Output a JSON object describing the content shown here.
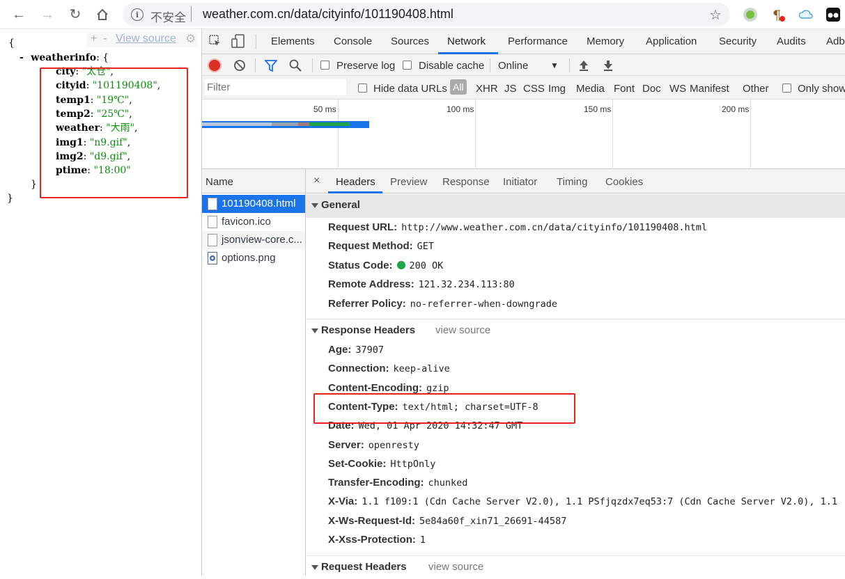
{
  "browser": {
    "insecure_label": "不安全",
    "url": "weather.com.cn/data/cityinfo/101190408.html",
    "icons": [
      "back-icon",
      "forward-icon",
      "reload-icon",
      "home-icon",
      "info-icon",
      "star-icon"
    ]
  },
  "json_view": {
    "tools_plus": "+",
    "tools_minus": "-",
    "view_source": "View source",
    "open_brace": "{",
    "root_key": "weatherinfo",
    "collapse": "-",
    "inner_open": "{",
    "inner_close": "}",
    "outer_close": "}",
    "fields": [
      {
        "key": "city",
        "value": "\"太仓\""
      },
      {
        "key": "cityid",
        "value": "\"101190408\""
      },
      {
        "key": "temp1",
        "value": "\"19℃\""
      },
      {
        "key": "temp2",
        "value": "\"25℃\""
      },
      {
        "key": "weather",
        "value": "\"大雨\""
      },
      {
        "key": "img1",
        "value": "\"n9.gif\""
      },
      {
        "key": "img2",
        "value": "\"d9.gif\""
      },
      {
        "key": "ptime",
        "value": "\"18:00\""
      }
    ]
  },
  "devtools": {
    "tabs": [
      "Elements",
      "Console",
      "Sources",
      "Network",
      "Performance",
      "Memory",
      "Application",
      "Security",
      "Audits",
      "Adb"
    ],
    "active_tab": "Network",
    "toolbar": {
      "preserve_log": "Preserve log",
      "disable_cache": "Disable cache",
      "throttle": "Online"
    },
    "filter": {
      "placeholder": "Filter",
      "hide_data_urls": "Hide data URLs",
      "types": [
        "All",
        "XHR",
        "JS",
        "CSS",
        "Img",
        "Media",
        "Font",
        "Doc",
        "WS",
        "Manifest",
        "Other"
      ],
      "only_show": "Only show"
    },
    "timeline_ticks": [
      "50 ms",
      "100 ms",
      "150 ms",
      "200 ms"
    ],
    "name_header": "Name",
    "files": [
      "101190408.html",
      "favicon.ico",
      "jsonview-core.c...",
      "options.png"
    ],
    "selected_file": "101190408.html",
    "detail_tabs": [
      "Headers",
      "Preview",
      "Response",
      "Initiator",
      "Timing",
      "Cookies"
    ],
    "close": "×",
    "general": {
      "title": "General",
      "rows": [
        {
          "key": "Request URL:",
          "value": "http://www.weather.com.cn/data/cityinfo/101190408.html"
        },
        {
          "key": "Request Method:",
          "value": "GET"
        },
        {
          "key": "Status Code:",
          "value": "200 OK"
        },
        {
          "key": "Remote Address:",
          "value": "121.32.234.113:80"
        },
        {
          "key": "Referrer Policy:",
          "value": "no-referrer-when-downgrade"
        }
      ]
    },
    "response_headers": {
      "title": "Response Headers",
      "view_source": "view source",
      "rows": [
        {
          "key": "Age:",
          "value": "37907"
        },
        {
          "key": "Connection:",
          "value": "keep-alive"
        },
        {
          "key": "Content-Encoding:",
          "value": "gzip"
        },
        {
          "key": "Content-Type:",
          "value": "text/html; charset=UTF-8"
        },
        {
          "key": "Date:",
          "value": "Wed, 01 Apr 2020 14:32:47 GMT"
        },
        {
          "key": "Server:",
          "value": "openresty"
        },
        {
          "key": "Set-Cookie:",
          "value": "HttpOnly"
        },
        {
          "key": "Transfer-Encoding:",
          "value": "chunked"
        },
        {
          "key": "X-Via:",
          "value": "1.1 f109:1 (Cdn Cache Server V2.0), 1.1 PSfjqzdx7eq53:7 (Cdn Cache Server V2.0), 1.1"
        },
        {
          "key": "X-Ws-Request-Id:",
          "value": "5e84a60f_xin71_26691-44587"
        },
        {
          "key": "X-Xss-Protection:",
          "value": "1"
        }
      ]
    },
    "request_headers": {
      "title": "Request Headers",
      "view_source": "view source"
    },
    "colors": {
      "accent": "#1a73e8",
      "record": "#d93025",
      "status_ok": "#1ea446",
      "highlight_box": "#e8231c"
    }
  }
}
